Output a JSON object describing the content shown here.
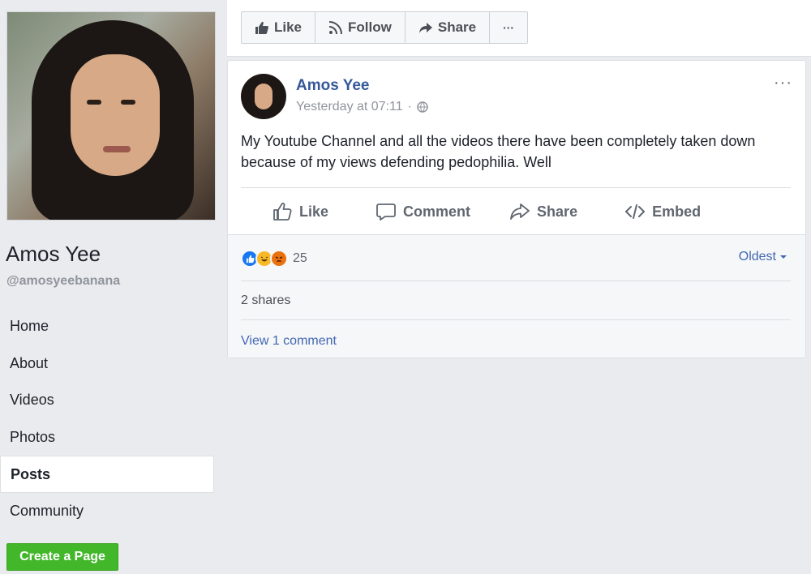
{
  "page": {
    "name": "Amos Yee",
    "handle": "@amosyeebanana"
  },
  "nav": {
    "items": [
      {
        "label": "Home"
      },
      {
        "label": "About"
      },
      {
        "label": "Videos"
      },
      {
        "label": "Photos"
      },
      {
        "label": "Posts",
        "active": true
      },
      {
        "label": "Community"
      }
    ],
    "create_page_label": "Create a Page"
  },
  "toolbar": {
    "like_label": "Like",
    "follow_label": "Follow",
    "share_label": "Share",
    "more_label": "···"
  },
  "post": {
    "author": "Amos Yee",
    "timestamp": "Yesterday at 07:11",
    "separator": "·",
    "more_label": "···",
    "text": "My Youtube Channel and all the videos there have been completely taken down because of my views defending pedophilia. Well",
    "actions": {
      "like": "Like",
      "comment": "Comment",
      "share": "Share",
      "embed": "Embed"
    },
    "reactions": {
      "types": [
        "like",
        "haha",
        "angry"
      ],
      "count": "25"
    },
    "sort_label": "Oldest",
    "shares_text": "2 shares",
    "view_comments_text": "View 1 comment"
  },
  "colors": {
    "link": "#365899",
    "create_button": "#42b72a",
    "background": "#e9ebee"
  }
}
